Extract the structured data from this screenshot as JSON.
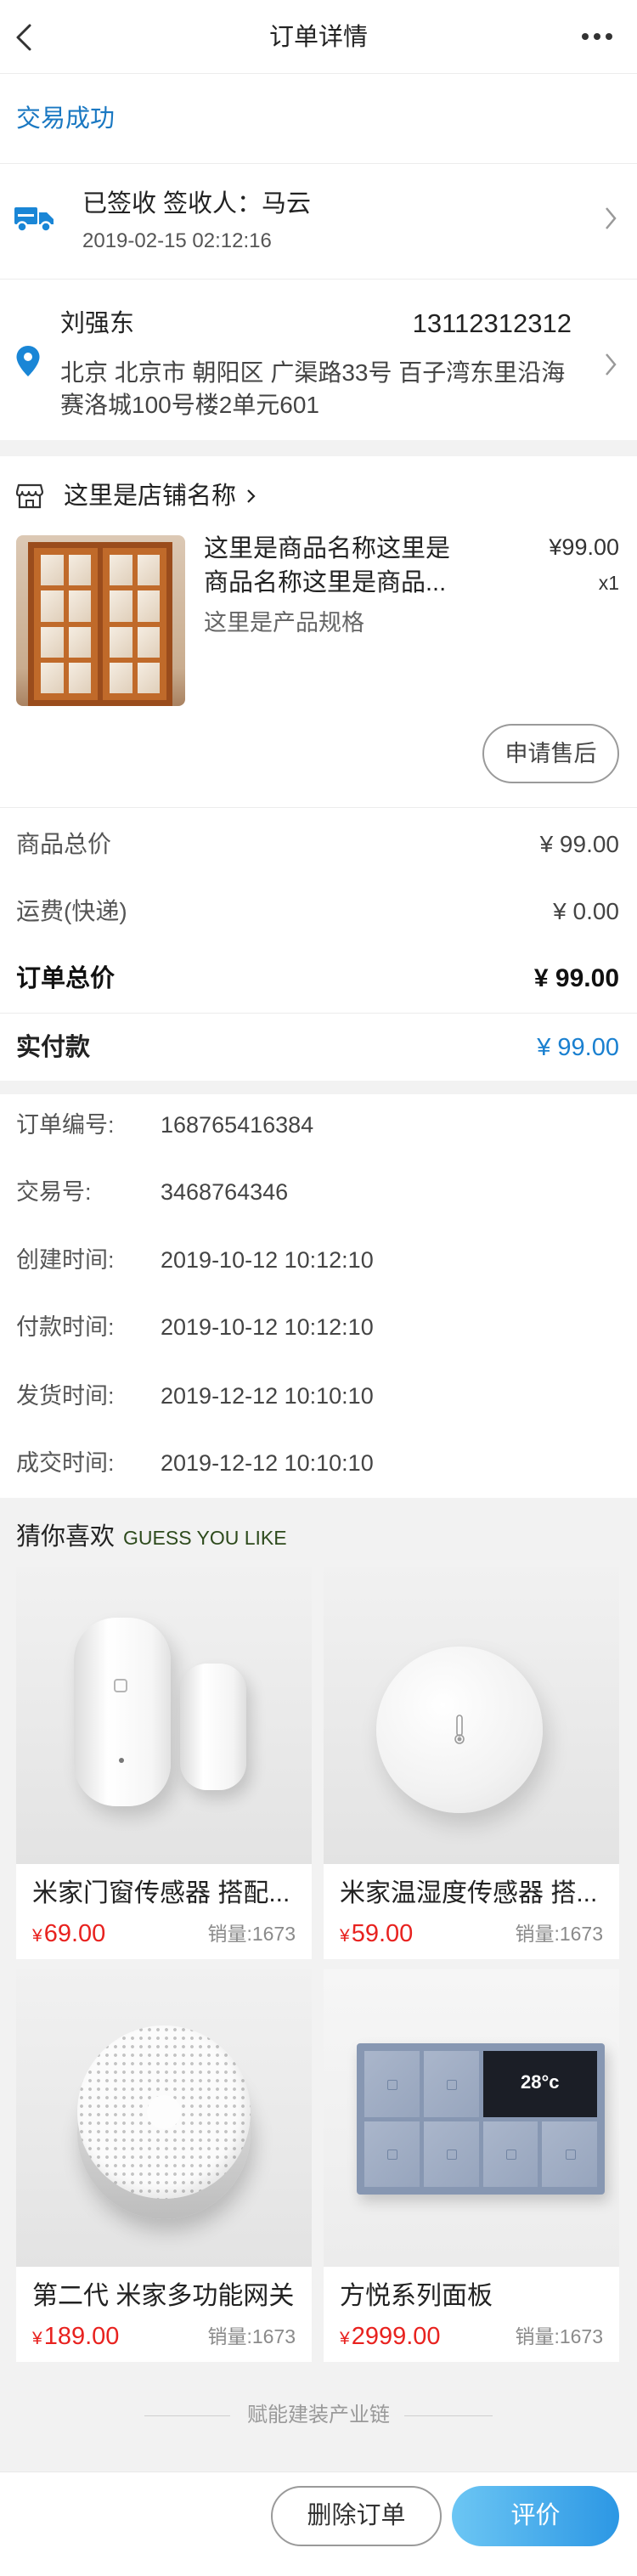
{
  "header": {
    "title": "订单详情",
    "back_icon": "chevron-left-icon",
    "more_icon": "more-dots-icon"
  },
  "status": {
    "text": "交易成功"
  },
  "logistics": {
    "icon": "truck-icon",
    "status_text": "已签收 签收人：马云",
    "time": "2019-02-15 02:12:16"
  },
  "address": {
    "icon": "location-pin-icon",
    "name": "刘强东",
    "phone": "13112312312",
    "lines": [
      "北京 北京市 朝阳区 广渠路33号 百子湾东里沿海",
      "赛洛城100号楼2单元601"
    ]
  },
  "order_item": {
    "store_icon": "store-icon",
    "store_name": "这里是店铺名称",
    "name_lines": [
      "这里是商品名称这里是",
      "商品名称这里是商品..."
    ],
    "spec": "这里是产品规格",
    "price": "¥99.00",
    "quantity": "x1",
    "after_sale_label": "申请售后"
  },
  "summary": {
    "rows": [
      {
        "label": "商品总价",
        "value": "¥ 99.00"
      },
      {
        "label": "运费(快递)",
        "value": "¥ 0.00"
      },
      {
        "label": "订单总价",
        "value": "¥ 99.00"
      }
    ],
    "paid": {
      "label": "实付款",
      "value": "¥ 99.00"
    }
  },
  "info": {
    "rows": [
      {
        "label": "订单编号:",
        "value": "168765416384"
      },
      {
        "label": "交易号:",
        "value": "3468764346"
      },
      {
        "label": "创建时间:",
        "value": "2019-10-12 10:12:10"
      },
      {
        "label": "付款时间:",
        "value": "2019-10-12 10:12:10"
      },
      {
        "label": "发货时间:",
        "value": "2019-12-12 10:10:10"
      },
      {
        "label": "成交时间:",
        "value": "2019-12-12 10:10:10"
      }
    ]
  },
  "recommend": {
    "title": "猜你喜欢",
    "subtitle": "GUESS YOU LIKE",
    "currency": "¥",
    "items": [
      {
        "title": "米家门窗传感器 搭配...",
        "price": "69.00",
        "sales": "销量:1673"
      },
      {
        "title": "米家温湿度传感器 搭...",
        "price": "59.00",
        "sales": "销量:1673"
      },
      {
        "title": "第二代 米家多功能网关",
        "price": "189.00",
        "sales": "销量:1673"
      },
      {
        "title": "方悦系列面板",
        "price": "2999.00",
        "sales": "销量:1673",
        "screen_text": "28°c"
      }
    ]
  },
  "footer": {
    "slogan": "赋能建装产业链"
  },
  "actions": {
    "delete_label": "删除订单",
    "review_label": "评价"
  },
  "colors": {
    "accent": "#1a80d0",
    "status": "#1a78c2",
    "price_red": "#e8221f",
    "page_bg": "#f2f2f2"
  }
}
